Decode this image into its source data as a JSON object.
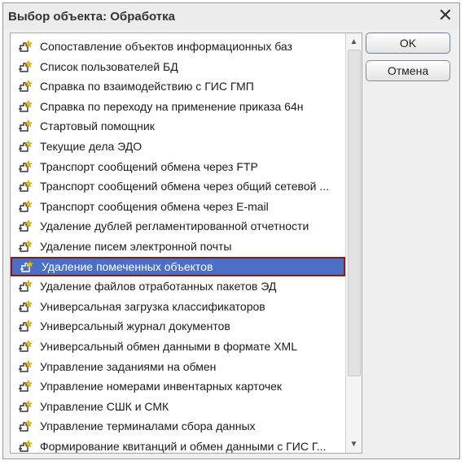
{
  "dialog": {
    "title": "Выбор объекта: Обработка",
    "close_symbol": "✕"
  },
  "buttons": {
    "ok": "OK",
    "cancel": "Отмена"
  },
  "list": {
    "selected_index": 11,
    "items": [
      "Сопоставление объектов информационных баз",
      "Список пользователей БД",
      "Справка по взаимодействию с ГИС ГМП",
      "Справка по переходу на применение приказа 64н",
      "Стартовый помощник",
      "Текущие дела ЭДО",
      "Транспорт сообщений обмена через FTP",
      "Транспорт сообщений обмена через общий сетевой ...",
      "Транспорт сообщения обмена через E-mail",
      "Удаление дублей регламентированной отчетности",
      "Удаление писем электронной почты",
      "Удаление помеченных объектов",
      "Удаление файлов отработанных пакетов ЭД",
      "Универсальная загрузка классификаторов",
      "Универсальный журнал документов",
      "Универсальный обмен данными в формате XML",
      "Управление заданиями на обмен",
      "Управление номерами инвентарных карточек",
      "Управление СШК и СМК",
      "Управление терминалами сбора данных",
      "Формирование квитанций и обмен данными с ГИС Г..."
    ]
  },
  "scrollbar": {
    "up": "▲",
    "down": "▼"
  },
  "icons": {
    "item": "processing-icon",
    "accent": "#f2c200"
  }
}
